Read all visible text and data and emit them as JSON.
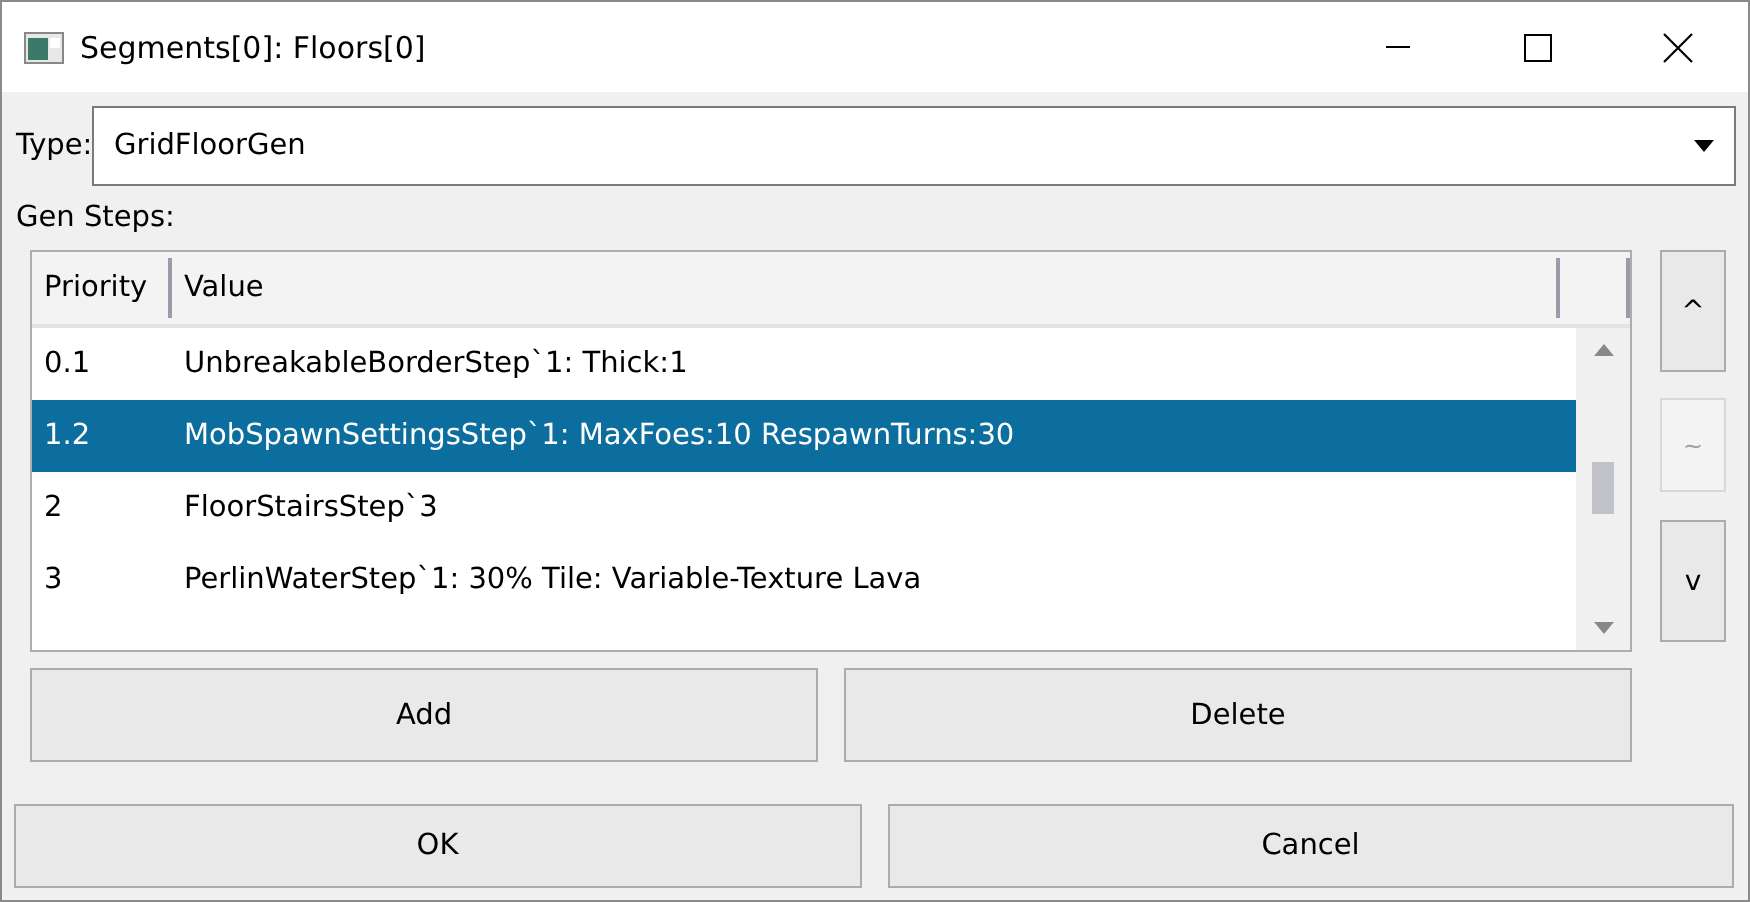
{
  "window": {
    "title": "Segments[0]: Floors[0]"
  },
  "type_field": {
    "label": "Type:",
    "value": "GridFloorGen"
  },
  "gen_steps": {
    "label": "Gen Steps:",
    "columns": [
      "Priority",
      "Value"
    ],
    "rows": [
      {
        "priority": "0.1",
        "value": "UnbreakableBorderStep`1: Thick:1",
        "selected": false
      },
      {
        "priority": "1.2",
        "value": "MobSpawnSettingsStep`1: MaxFoes:10 RespawnTurns:30",
        "selected": true
      },
      {
        "priority": "2",
        "value": "FloorStairsStep`3",
        "selected": false
      },
      {
        "priority": "3",
        "value": "PerlinWaterStep`1: 30% Tile: Variable-Texture Lava",
        "selected": false
      }
    ],
    "side_buttons": [
      {
        "label": "^",
        "kind": "up",
        "disabled": false
      },
      {
        "label": "~",
        "kind": "switch",
        "disabled": true
      },
      {
        "label": "v",
        "kind": "down",
        "disabled": false
      }
    ],
    "buttons": [
      "Add",
      "Delete"
    ]
  },
  "dialog_buttons": [
    "OK",
    "Cancel"
  ]
}
